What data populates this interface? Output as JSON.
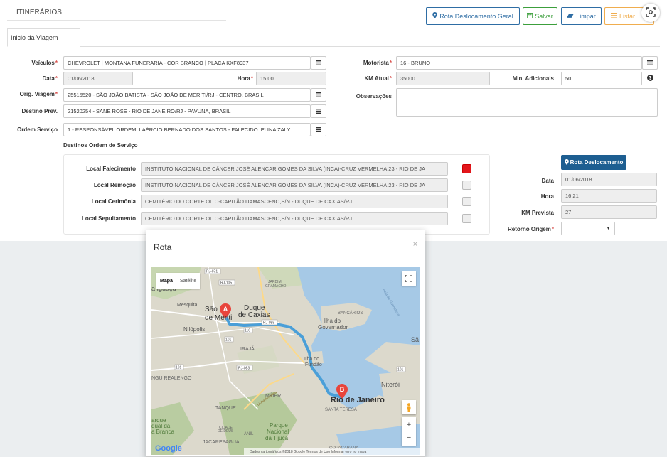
{
  "header": {
    "title": "ITINERÁRIOS",
    "buttons": {
      "rota_geral": "Rota Deslocamento Geral",
      "salvar": "Salvar",
      "limpar": "Limpar",
      "listar": "Listar"
    }
  },
  "tab": {
    "label": "Inicio da Viagem"
  },
  "form": {
    "veiculos": {
      "label": "Veículos",
      "value": "CHEVROLET | MONTANA FUNERARIA - COR BRANCO | PLACA KXF8937"
    },
    "data": {
      "label": "Data",
      "value": "01/06/2018"
    },
    "hora": {
      "label": "Hora",
      "value": "15:00"
    },
    "orig_viagem": {
      "label": "Orig. Viagem",
      "value": "25515520 - SÃO JOÃO BATISTA - SÃO JOÃO DE MERITI/RJ - CENTRO, BRASIL"
    },
    "destino_prev": {
      "label": "Destino Prev.",
      "value": "21520254 - SANE ROSE - RIO DE JANEIRO/RJ - PAVUNA, BRASIL"
    },
    "ordem_servico": {
      "label": "Ordem Serviço",
      "value": "1 - RESPONSÁVEL ORDEM: LAÉRCIO BERNADO DOS SANTOS - FALECIDO: ELINA ZALY"
    },
    "motorista": {
      "label": "Motorista",
      "value": "16 - BRUNO"
    },
    "km_atual": {
      "label": "KM Atual",
      "value": "35000"
    },
    "min_adicionais": {
      "label": "Min. Adicionais",
      "value": "50"
    },
    "observacoes": {
      "label": "Observações",
      "value": ""
    }
  },
  "destinos": {
    "section_title": "Destinos Ordem de Serviço",
    "rows": [
      {
        "label": "Local Falecimento",
        "value": "INSTITUTO NACIONAL DE CÂNCER JOSÉ ALENCAR GOMES DA SILVA (INCA)-CRUZ VERMELHA,23 - RIO DE JA",
        "checked": true
      },
      {
        "label": "Local Remoção",
        "value": "INSTITUTO NACIONAL DE CÂNCER JOSÉ ALENCAR GOMES DA SILVA (INCA)-CRUZ VERMELHA,23 - RIO DE JA",
        "checked": false
      },
      {
        "label": "Local Cerimônia",
        "value": "CEMITÉRIO DO CORTE OITO-CAPITÃO DAMASCENO,S/N - DUQUE DE CAXIAS/RJ",
        "checked": false
      },
      {
        "label": "Local Sepultamento",
        "value": "CEMITÉRIO DO CORTE OITO-CAPITÃO DAMASCENO,S/N - DUQUE DE CAXIAS/RJ",
        "checked": false
      }
    ]
  },
  "right_panel": {
    "rota_button": "Rota Deslocamento",
    "data": {
      "label": "Data",
      "value": "01/06/2018"
    },
    "hora": {
      "label": "Hora",
      "value": "16:21"
    },
    "km_prevista": {
      "label": "KM Prevista",
      "value": "27"
    },
    "retorno_origem": {
      "label": "Retorno Origem",
      "value": ""
    }
  },
  "modal": {
    "title": "Rota",
    "close": "×",
    "map": {
      "tab_map": "Mapa",
      "tab_satellite": "Satélite",
      "marker_a": "A",
      "marker_b": "B",
      "labels": {
        "iguacu": "a Iguaçu",
        "mesquita": "Mesquita",
        "sao_joao_1": "São",
        "sao_joao_2": "o de",
        "meriti": "de Meriti",
        "duque1": "Duque",
        "duque2": "de Caxias",
        "nilopolis": "Nilópolis",
        "ilha1": "Ilha do",
        "ilha2": "Governador",
        "iraja": "IRAJÁ",
        "fundao1": "Ilha do",
        "fundao2": "Fundão",
        "realengo": "NGU REALENGO",
        "meier": "MÉIER",
        "niteroi": "Niterói",
        "tanque": "TANQUE",
        "rio": "Rio de Janeiro",
        "santa_teresa": "SANTA TERESA",
        "parque1": "Parque",
        "parque2": "Nacional",
        "parque3": "da Tijuca",
        "jacarepagua": "JACAREPAGUA",
        "copacabana": "COPACABANA",
        "jardim": "JARDIM",
        "gramacho": "GRAMACHO",
        "bancarios": "BANCÁRIOS",
        "baia": "Baía de Guanabara",
        "sa": "Sã",
        "anil": "ANIL",
        "cidade1": "CIDADE",
        "cidade2": "DE DEUS",
        "parque_left1": "arque",
        "parque_left2": "dual da",
        "parque_left3": "a Branca",
        "road_rj105": "RJ-105",
        "road_rj085": "RJ-085",
        "road_116": "116",
        "road_101a": "101",
        "road_101b": "101",
        "road_101c": "101",
        "road_rj083": "RJ-083",
        "road_rj071": "RJ-071",
        "linha": "Linha Amarela"
      },
      "google": "Google",
      "attribution": "Dados cartográficos ©2018 Google  Termos de Uso  Informar erro no mapa"
    }
  },
  "icons": {
    "map_marker": "map-marker-icon",
    "save": "save-icon",
    "eraser": "eraser-icon",
    "list": "list-icon",
    "question": "question-icon",
    "fullscreen": "fullscreen-icon",
    "pegman": "pegman-icon"
  },
  "colors": {
    "primary": "#1d5e91",
    "success": "#3c9f3c",
    "warning": "#f0ad4e",
    "danger": "#e3161b",
    "route": "#4a9fd8"
  }
}
